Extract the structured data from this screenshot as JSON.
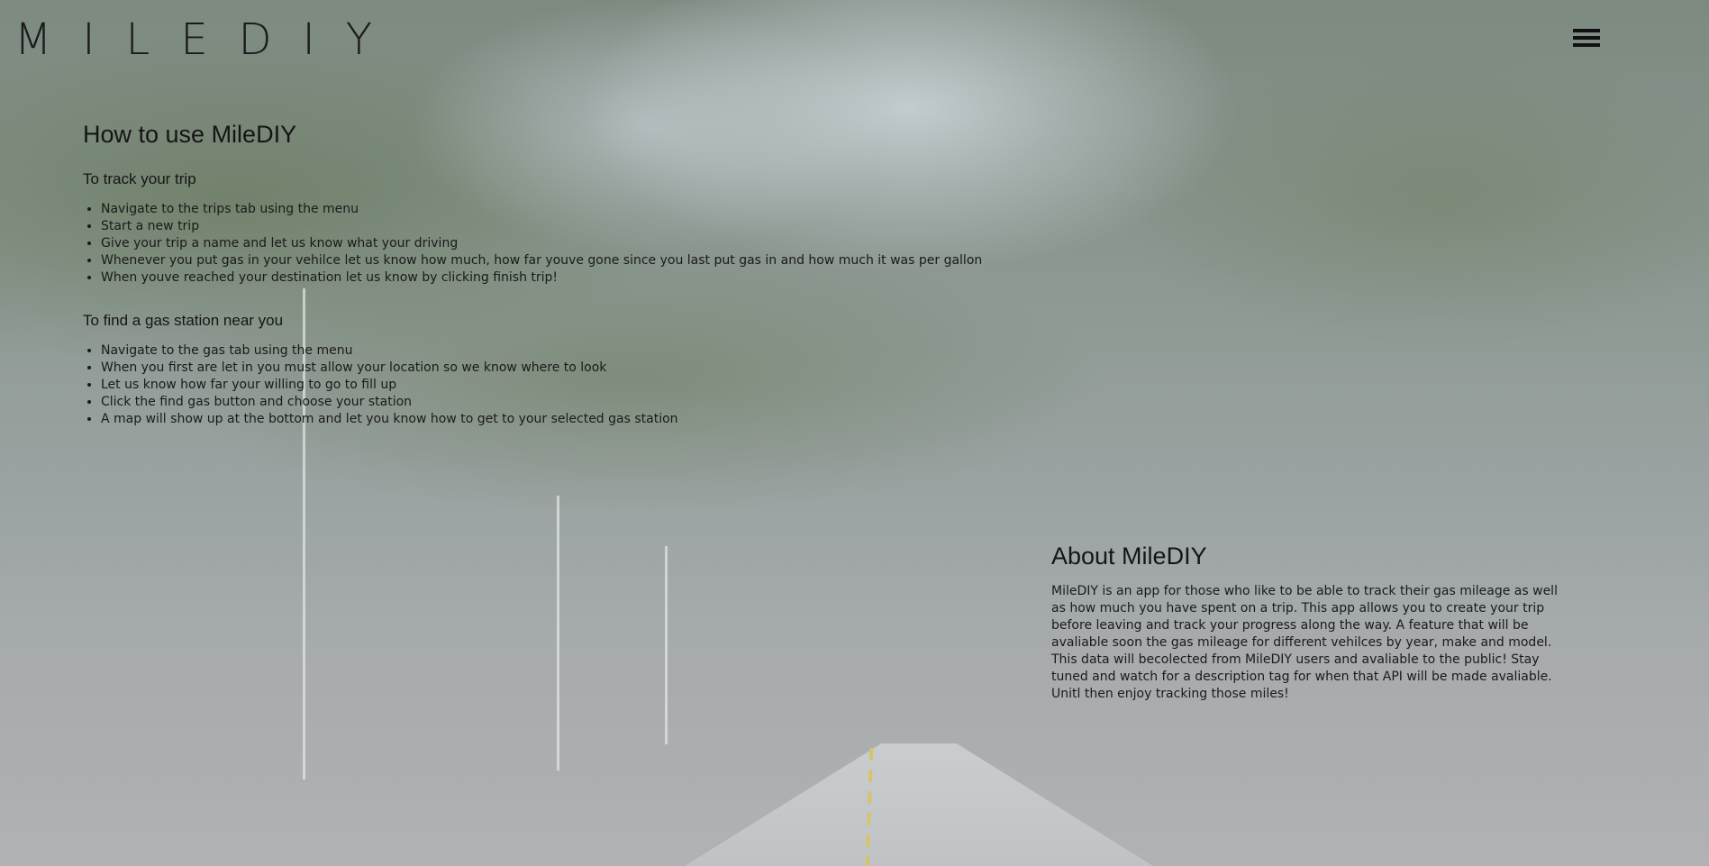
{
  "header": {
    "logo_text": "MILEDIY",
    "menu_icon": "hamburger-menu-icon"
  },
  "howto": {
    "title": "How to use MileDIY",
    "track": {
      "heading": "To track your trip",
      "steps": [
        "Navigate to the trips tab using the menu",
        "Start a new trip",
        "Give your trip a name and let us know what your driving",
        "Whenever you put gas in your vehilce let us know how much, how far youve gone since you last put gas in and how much it was per gallon",
        "When youve reached your destination let us know by clicking finish trip!"
      ]
    },
    "gas": {
      "heading": "To find a gas station near you",
      "steps": [
        "Navigate to the gas tab using the menu",
        "When you first are let in you must allow your location so we know where to look",
        "Let us know how far your willing to go to fill up",
        "Click the find gas button and choose your station",
        "A map will show up at the bottom and let you know how to get to your selected gas station"
      ]
    }
  },
  "about": {
    "title": "About MileDIY",
    "body": "MileDIY is an app for those who like to be able to track their gas mileage as well as how much you have spent on a trip. This app allows you to create your trip before leaving and track your progress along the way. A feature that will be avaliable soon the gas mileage for different vehilces by year, make and model. This data will becolected from MileDIY users and avaliable to the public! Stay tuned and watch for a description tag for when that API will be made avaliable. Unitl then enjoy tracking those miles!"
  },
  "colors": {
    "text": "#111111",
    "background_top": "#7d8a80",
    "background_bottom": "#b0b2b4"
  }
}
